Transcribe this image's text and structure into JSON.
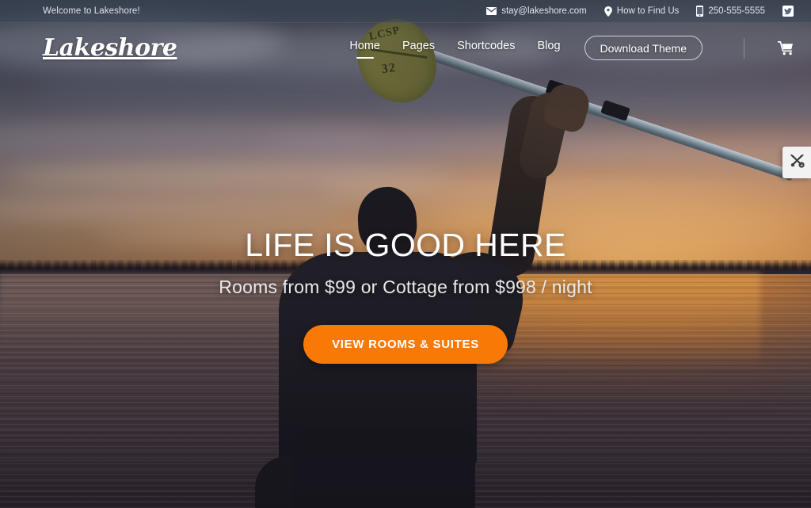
{
  "topbar": {
    "welcome": "Welcome to Lakeshore!",
    "email": "stay@lakeshore.com",
    "email_icon": "envelope-icon",
    "find_us": "How to Find Us",
    "find_us_icon": "location-pin-icon",
    "phone": "250-555-5555",
    "phone_icon": "mobile-phone-icon",
    "social": "Twitter",
    "social_icon": "twitter-icon",
    "background_color": "#3a4656"
  },
  "header": {
    "logo": "Lakeshore",
    "nav": [
      {
        "label": "Home",
        "active": true
      },
      {
        "label": "Pages",
        "active": false
      },
      {
        "label": "Shortcodes",
        "active": false
      },
      {
        "label": "Blog",
        "active": false
      }
    ],
    "download_button": "Download Theme",
    "cart_icon": "shopping-cart-icon"
  },
  "hero": {
    "title": "LIFE IS GOOD HERE",
    "subtitle": "Rooms from $99 or Cottage from $998 / night",
    "cta": "VIEW ROOMS & SUITES",
    "cta_color": "#f97906"
  },
  "theme_panel": {
    "icon": "tools-wrench-screwdriver-icon"
  },
  "background": {
    "description": "Kayaker silhouette raising a paddle over a lake at sunset",
    "paddle_label_top": "LCSP",
    "paddle_label_bottom": "32",
    "sky_top_color": "#3f4654",
    "sky_horizon_color": "#dcab7e",
    "water_color": "#4b4450",
    "water_glow_color": "#d68339"
  }
}
